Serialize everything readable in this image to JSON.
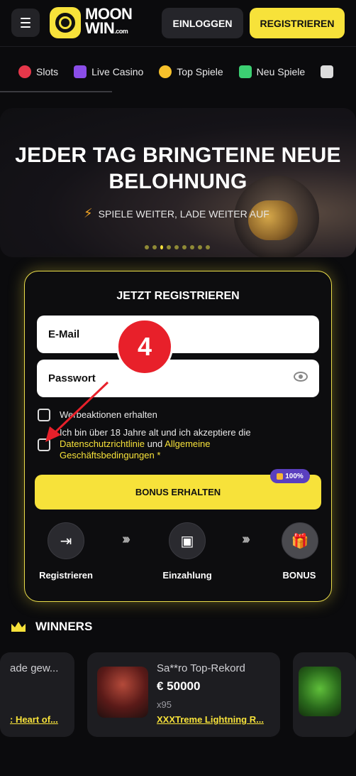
{
  "header": {
    "logo_line1": "MOON",
    "logo_line2": "WIN",
    "logo_suffix": ".com",
    "login_label": "EINLOGGEN",
    "register_label": "REGISTRIEREN"
  },
  "catnav": {
    "items": [
      {
        "label": "Slots",
        "icon": "slots-icon",
        "color": "#e6374a"
      },
      {
        "label": "Live Casino",
        "icon": "live-casino-icon",
        "color": "#8a4de8"
      },
      {
        "label": "Top Spiele",
        "icon": "top-games-icon",
        "color": "#f7c12b"
      },
      {
        "label": "Neu Spiele",
        "icon": "new-games-icon",
        "color": "#3ccf72"
      }
    ]
  },
  "hero": {
    "title_line1": "JEDER TAG BRINGTEINE NEUE",
    "title_line2": "BELOHNUNG",
    "subtitle": "SPIELE WEITER, LADE WEITER AUF"
  },
  "register": {
    "title": "JETZT REGISTRIEREN",
    "email_placeholder": "E-Mail",
    "password_placeholder": "Passwort",
    "promo_label": "Werbeaktionen erhalten",
    "terms_text1": "Ich bin über 18 Jahre alt und ich akzeptiere die",
    "terms_link1": "Datenschutzrichtlinie",
    "terms_and": "und",
    "terms_link2": "Allgemeine",
    "terms_link3": "Geschäftsbedingungen",
    "terms_required": "*",
    "bonus_button": "BONUS ERHALTEN",
    "bonus_badge": "100%",
    "steps": [
      {
        "label": "Registrieren"
      },
      {
        "label": "Einzahlung"
      },
      {
        "label": "BONUS"
      }
    ]
  },
  "winners": {
    "title": "WINNERS",
    "cards": [
      {
        "name": "ade gew...",
        "game": ": Heart of..."
      },
      {
        "name": "Sa**ro Top-Rekord",
        "amount": "€ 50000",
        "multiplier": "x95",
        "game": "XXXTreme Lightning R..."
      }
    ]
  },
  "annotation": {
    "step_number": "4"
  },
  "colors": {
    "accent": "#f7e23a",
    "annotation_red": "#e8202a"
  }
}
